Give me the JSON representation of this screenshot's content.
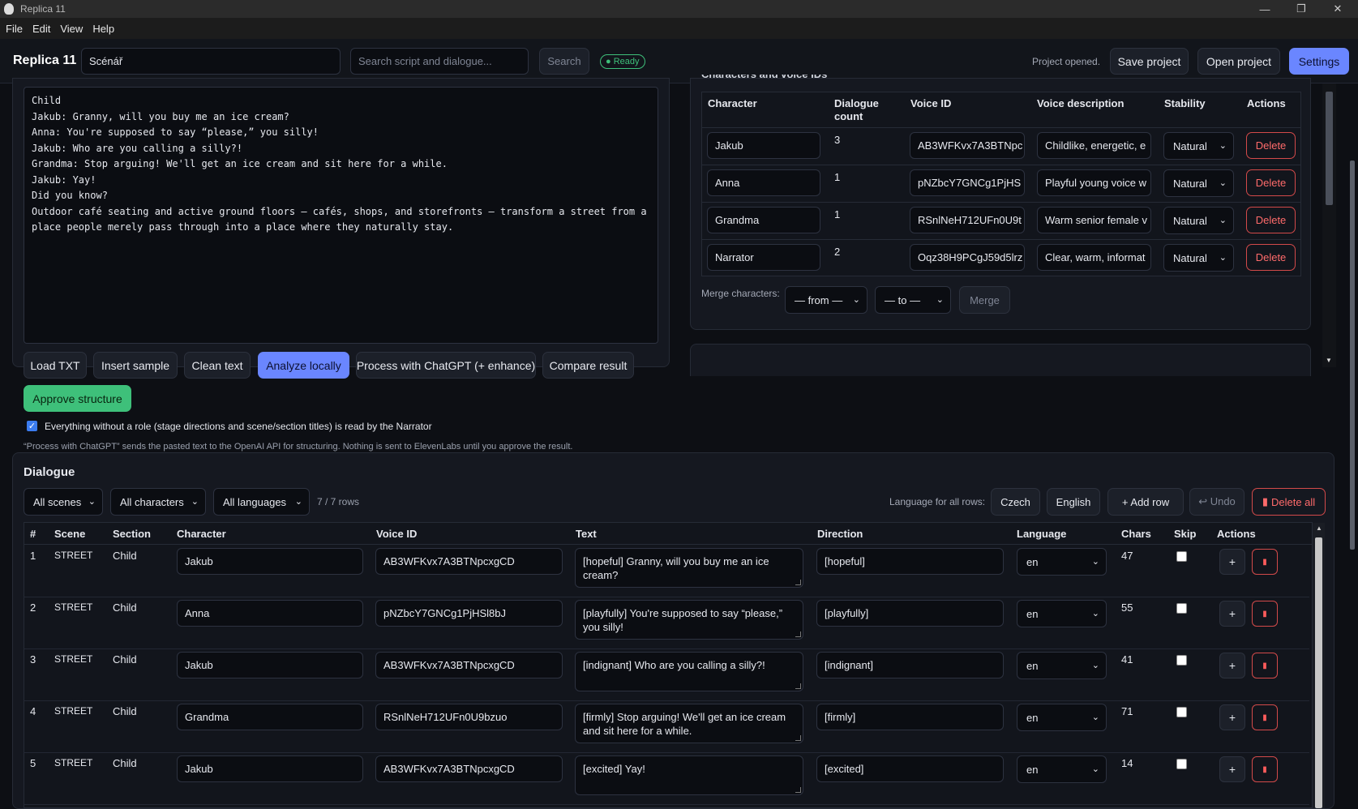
{
  "window": {
    "title": "Replica 11",
    "minimize": "—",
    "restore": "❐",
    "close": "✕"
  },
  "menu": [
    "File",
    "Edit",
    "View",
    "Help"
  ],
  "header": {
    "brand": "Replica 11",
    "project_name": "Scénář",
    "search_placeholder": "Search script and dialogue...",
    "search_button": "Search",
    "status_badge": "● Ready",
    "status_message": "Project opened.",
    "save_project": "Save project",
    "open_project": "Open project",
    "settings": "Settings"
  },
  "script": {
    "text": "Child\nJakub: Granny, will you buy me an ice cream?\nAnna: You're supposed to say “please,” you silly!\nJakub: Who are you calling a silly?!\nGrandma: Stop arguing! We'll get an ice cream and sit here for a while.\nJakub: Yay!\nDid you know?\nOutdoor café seating and active ground floors — cafés, shops, and storefronts — transform a street from a place people merely pass through into a place where they naturally stay.",
    "buttons": [
      "Load TXT",
      "Insert sample",
      "Clean text",
      "Analyze locally",
      "Process with ChatGPT (+ enhance)",
      "Compare result"
    ],
    "approve": "Approve structure",
    "narrator_checkbox_label": "Everything without a role (stage directions and scene/section titles) is read by the Narrator",
    "narrator_checked": true,
    "note": "“Process with ChatGPT” sends the pasted text to the OpenAI API for structuring. Nothing is sent to ElevenLabs until you approve the result."
  },
  "characters": {
    "section_title": "Characters and voice IDs",
    "columns": [
      "Character",
      "Dialogue count",
      "Voice ID",
      "Voice description",
      "Stability",
      "Actions"
    ],
    "rows": [
      {
        "name": "Jakub",
        "count": "3",
        "voice_id": "AB3WFKvx7A3BTNpc",
        "description": "Childlike, energetic, e",
        "stability": "Natural",
        "action": "Delete"
      },
      {
        "name": "Anna",
        "count": "1",
        "voice_id": "pNZbcY7GNCg1PjHS",
        "description": "Playful young voice w",
        "stability": "Natural",
        "action": "Delete"
      },
      {
        "name": "Grandma",
        "count": "1",
        "voice_id": "RSnlNeH712UFn0U9t",
        "description": "Warm senior female v",
        "stability": "Natural",
        "action": "Delete"
      },
      {
        "name": "Narrator",
        "count": "2",
        "voice_id": "Oqz38H9PCgJ59d5lrz",
        "description": "Clear, warm, informat",
        "stability": "Natural",
        "action": "Delete"
      }
    ],
    "merge_label": "Merge characters:",
    "merge_from": "— from —",
    "merge_to": "— to —",
    "merge_button": "Merge"
  },
  "dialogue": {
    "title": "Dialogue",
    "filter_scenes": "All scenes",
    "filter_characters": "All characters",
    "filter_languages": "All languages",
    "row_count": "7 / 7 rows",
    "language_all_label": "Language for all rows:",
    "lang_czech": "Czech",
    "lang_english": "English",
    "add_row": "+ Add row",
    "undo": "↩ Undo",
    "delete_all": "Delete all",
    "columns": [
      "#",
      "Scene",
      "Section",
      "Character",
      "Voice ID",
      "Text",
      "Direction",
      "Language",
      "Chars",
      "Skip",
      "Actions"
    ],
    "rows": [
      {
        "num": "1",
        "scene": "STREET",
        "section": "Child",
        "character": "Jakub",
        "voice_id": "AB3WFKvx7A3BTNpcxgCD",
        "text": "[hopeful] Granny, will you buy me an ice cream?",
        "direction": "[hopeful]",
        "language": "en",
        "chars": "47",
        "skip": false
      },
      {
        "num": "2",
        "scene": "STREET",
        "section": "Child",
        "character": "Anna",
        "voice_id": "pNZbcY7GNCg1PjHSl8bJ",
        "text": "[playfully] You're supposed to say “please,” you silly!",
        "direction": "[playfully]",
        "language": "en",
        "chars": "55",
        "skip": false
      },
      {
        "num": "3",
        "scene": "STREET",
        "section": "Child",
        "character": "Jakub",
        "voice_id": "AB3WFKvx7A3BTNpcxgCD",
        "text": "[indignant] Who are you calling a silly?!",
        "direction": "[indignant]",
        "language": "en",
        "chars": "41",
        "skip": false
      },
      {
        "num": "4",
        "scene": "STREET",
        "section": "Child",
        "character": "Grandma",
        "voice_id": "RSnlNeH712UFn0U9bzuo",
        "text": "[firmly] Stop arguing! We'll get an ice cream and sit here for a while.",
        "direction": "[firmly]",
        "language": "en",
        "chars": "71",
        "skip": false
      },
      {
        "num": "5",
        "scene": "STREET",
        "section": "Child",
        "character": "Jakub",
        "voice_id": "AB3WFKvx7A3BTNpcxgCD",
        "text": "[excited] Yay!",
        "direction": "[excited]",
        "language": "en",
        "chars": "14",
        "skip": false
      }
    ]
  }
}
